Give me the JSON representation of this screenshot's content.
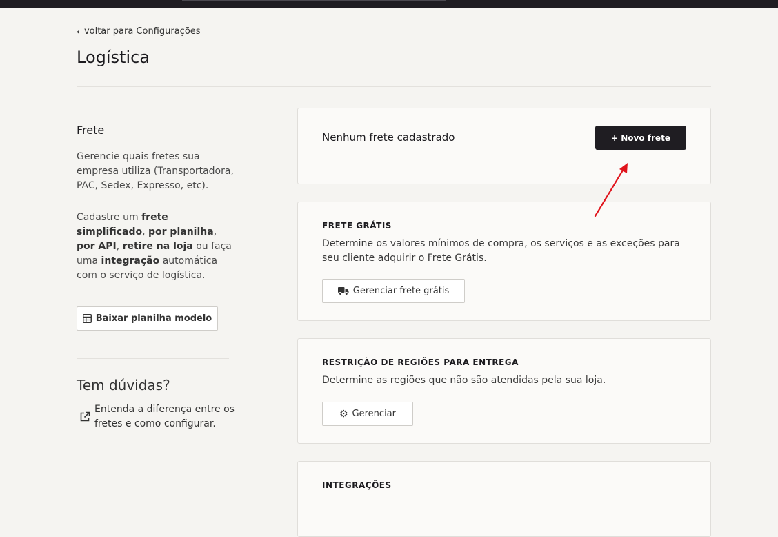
{
  "back_link": {
    "label": "voltar para Configurações"
  },
  "page": {
    "title": "Logística"
  },
  "sidebar": {
    "title": "Frete",
    "desc1": "Gerencie quais fretes sua empresa utiliza (Transportadora, PAC, Sedex, Expresso, etc).",
    "desc2_parts": [
      "Cadastre um ",
      "frete simplificado",
      ", ",
      "por planilha",
      ", ",
      "por API",
      ", ",
      "retire na loja",
      " ou faça uma ",
      "integração",
      " automática com o serviço de logística."
    ],
    "download_button": "Baixar planilha modelo",
    "help_title": "Tem dúvidas?",
    "help_link": "Entenda a diferença entre os fretes e como configurar."
  },
  "freight_card": {
    "empty_text": "Nenhum frete cadastrado",
    "new_button": "+ Novo frete"
  },
  "free_shipping": {
    "title": "FRETE GRÁTIS",
    "description": "Determine os valores mínimos de compra, os serviços e as exceções para seu cliente adquirir o Frete Grátis.",
    "button": "Gerenciar frete grátis"
  },
  "region_restriction": {
    "title": "RESTRIÇÃO DE REGIÕES PARA ENTREGA",
    "description": "Determine as regiões que não são atendidas pela sua loja.",
    "button": "Gerenciar"
  },
  "integrations": {
    "title": "INTEGRAÇÕES"
  },
  "colors": {
    "primary": "#1f1d22",
    "annotation_arrow": "#e0141c",
    "background": "#f5f4f1"
  },
  "icons": [
    "chevron-left-icon",
    "table-icon",
    "external-link-icon",
    "truck-icon",
    "gear-icon"
  ]
}
